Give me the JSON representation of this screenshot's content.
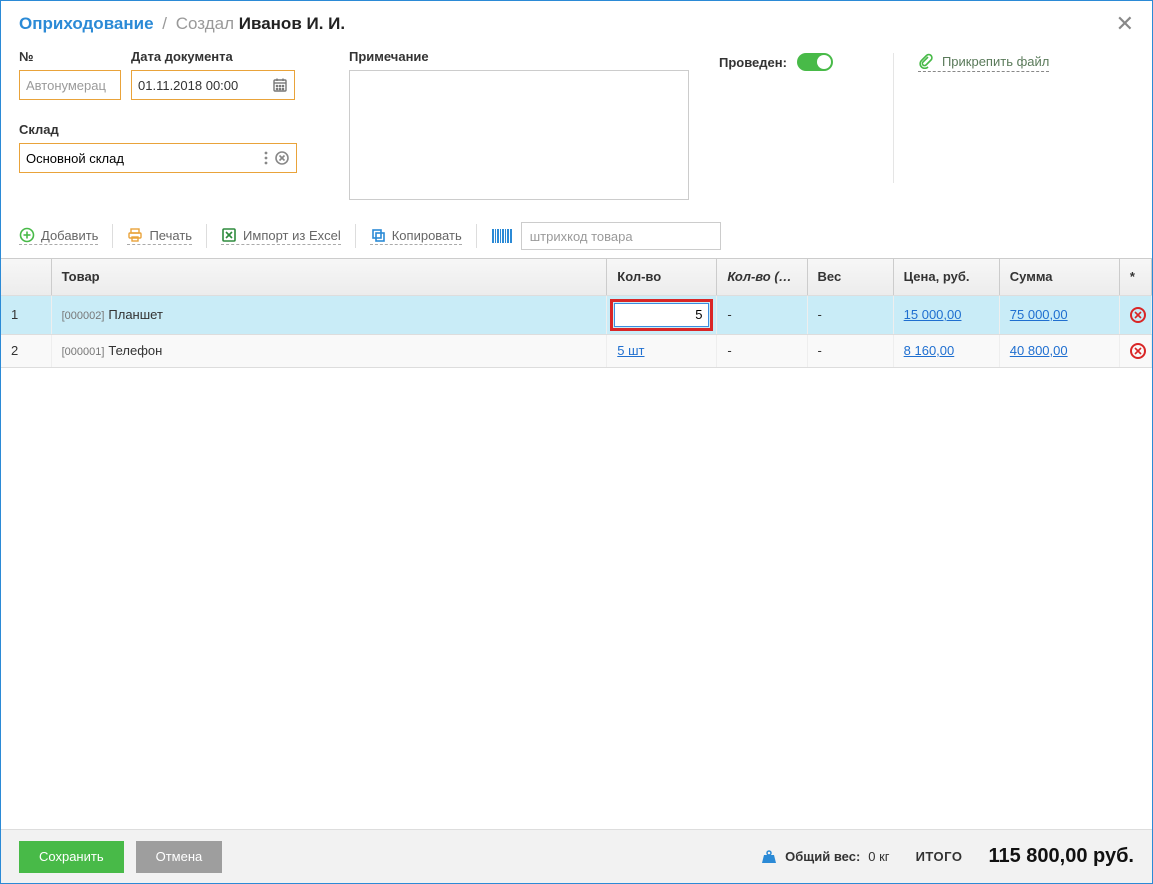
{
  "header": {
    "title": "Оприходование",
    "created_label": "Создал",
    "user": "Иванов И. И."
  },
  "form": {
    "number_label": "№",
    "number_placeholder": "Автонумерац",
    "date_label": "Дата документа",
    "date_value": "01.11.2018 00:00",
    "warehouse_label": "Склад",
    "warehouse_value": "Основной склад",
    "note_label": "Примечание",
    "posted_label": "Проведен:",
    "attach_label": "Прикрепить файл"
  },
  "toolbar": {
    "add": "Добавить",
    "print": "Печать",
    "import_excel": "Импорт из Excel",
    "copy": "Копировать",
    "barcode_placeholder": "штрихкод товара"
  },
  "columns": {
    "product": "Товар",
    "qty": "Кол-во",
    "qty2": "Кол-во (…",
    "weight": "Вес",
    "price": "Цена, руб.",
    "sum": "Сумма",
    "star": "*"
  },
  "rows": [
    {
      "idx": "1",
      "sku": "[000002]",
      "name": "Планшет",
      "qty_edit": "5",
      "qty2": "-",
      "weight": "-",
      "price": "15 000,00",
      "sum": "75 000,00",
      "selected": true,
      "editing": true
    },
    {
      "idx": "2",
      "sku": "[000001]",
      "name": "Телефон",
      "qty_link": "5 шт",
      "qty2": "-",
      "weight": "-",
      "price": "8 160,00",
      "sum": "40 800,00",
      "selected": false,
      "editing": false
    }
  ],
  "footer": {
    "save": "Сохранить",
    "cancel": "Отмена",
    "weight_label": "Общий вес:",
    "weight_value": "0 кг",
    "total_label": "ИТОГО",
    "total_value": "115 800,00 руб."
  }
}
